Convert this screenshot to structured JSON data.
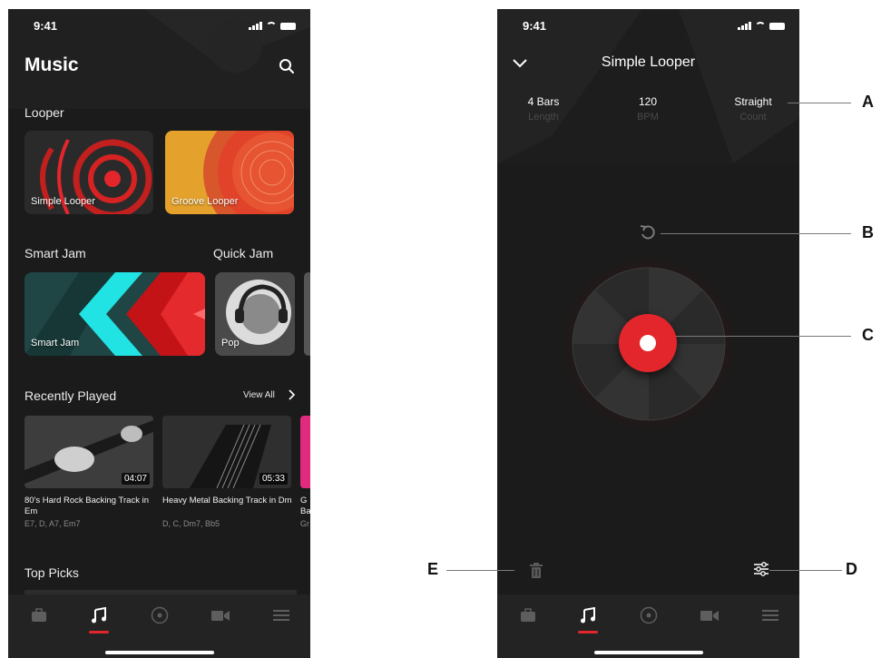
{
  "left_screen": {
    "status": {
      "time": "9:41"
    },
    "app_title": "Music",
    "looper": {
      "section_title": "Looper",
      "cards": [
        {
          "label": "Simple Looper"
        },
        {
          "label": "Groove Looper"
        }
      ]
    },
    "smart_jam": {
      "section_title": "Smart Jam",
      "card_label": "Smart Jam"
    },
    "quick_jam": {
      "section_title": "Quick Jam",
      "card_label": "Pop"
    },
    "recently_played": {
      "section_title": "Recently Played",
      "view_all": "View All",
      "items": [
        {
          "title": "80's Hard Rock Backing Track in Em",
          "chords": "E7, D, A7, Em7",
          "duration": "04:07"
        },
        {
          "title": "Heavy Metal Backing Track in Dm",
          "chords": "D, C, Dm7, Bb5",
          "duration": "05:33"
        },
        {
          "title": "G Ba",
          "chords": "Gr",
          "duration": ""
        }
      ]
    },
    "top_picks": {
      "section_title": "Top Picks"
    }
  },
  "right_screen": {
    "status": {
      "time": "9:41"
    },
    "title": "Simple Looper",
    "params": [
      {
        "value": "4 Bars",
        "label": "Length"
      },
      {
        "value": "120",
        "label": "BPM"
      },
      {
        "value": "Straight",
        "label": "Count"
      }
    ]
  },
  "callouts": {
    "a": "A",
    "b": "B",
    "c": "C",
    "d": "D",
    "e": "E"
  },
  "tab_icons": [
    "briefcase-icon",
    "music-note-icon",
    "compass-icon",
    "video-camera-icon",
    "menu-icon"
  ],
  "colors": {
    "accent": "#e3262b",
    "background": "#1b1b1b",
    "tabbar": "#232323"
  }
}
